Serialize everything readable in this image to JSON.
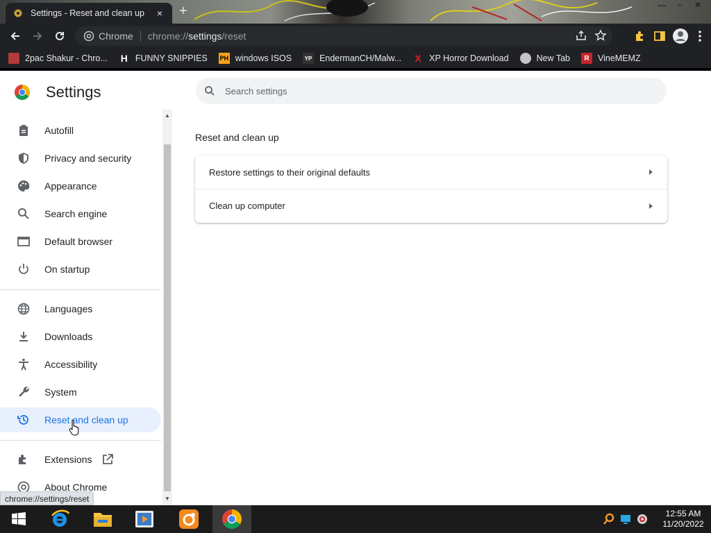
{
  "tab": {
    "title": "Settings - Reset and clean up",
    "close_icon": "×",
    "new_tab_icon": "+"
  },
  "window_controls": {
    "minimize": "—",
    "restore": "▫",
    "close": "✕"
  },
  "omnibox": {
    "site_label": "Chrome",
    "url_prefix": "chrome://",
    "url_host": "settings",
    "url_path": "/reset"
  },
  "bookmarks": [
    {
      "label": "2pac Shakur - Chro...",
      "icon": "image-icon",
      "badge": ""
    },
    {
      "label": "FUNNY SNIPPIES",
      "icon": "h-logo-icon",
      "badge": "H"
    },
    {
      "label": "windows ISOS",
      "icon": "ph-logo-icon",
      "badge": "PH"
    },
    {
      "label": "EndermanCH/Malw...",
      "icon": "yp-logo-icon",
      "badge": "YP"
    },
    {
      "label": "XP Horror Download",
      "icon": "x-logo-icon",
      "badge": "X"
    },
    {
      "label": "New Tab",
      "icon": "globe-icon",
      "badge": ""
    },
    {
      "label": "VineMEMZ",
      "icon": "r-logo-icon",
      "badge": "R"
    }
  ],
  "settings": {
    "title": "Settings",
    "search_placeholder": "Search settings",
    "nav": [
      {
        "label": "Autofill",
        "icon": "clipboard-icon"
      },
      {
        "label": "Privacy and security",
        "icon": "shield-icon"
      },
      {
        "label": "Appearance",
        "icon": "palette-icon"
      },
      {
        "label": "Search engine",
        "icon": "search-icon"
      },
      {
        "label": "Default browser",
        "icon": "browser-icon"
      },
      {
        "label": "On startup",
        "icon": "power-icon"
      },
      {
        "label": "Languages",
        "icon": "globe-icon"
      },
      {
        "label": "Downloads",
        "icon": "download-icon"
      },
      {
        "label": "Accessibility",
        "icon": "accessibility-icon"
      },
      {
        "label": "System",
        "icon": "wrench-icon"
      },
      {
        "label": "Reset and clean up",
        "icon": "history-icon",
        "active": true
      },
      {
        "label": "Extensions",
        "icon": "puzzle-icon"
      },
      {
        "label": "About Chrome",
        "icon": "chrome-icon"
      }
    ],
    "section_title": "Reset and clean up",
    "rows": [
      {
        "label": "Restore settings to their original defaults"
      },
      {
        "label": "Clean up computer"
      }
    ]
  },
  "status_url": "chrome://settings/reset",
  "taskbar": {
    "apps": [
      "start-icon",
      "internet-explorer-icon",
      "file-explorer-icon",
      "media-player-icon",
      "uc-browser-icon",
      "chrome-icon"
    ],
    "time": "12:55 AM",
    "date": "11/20/2022"
  },
  "colors": {
    "accent": "#1a73e8",
    "active_bg": "#e8f0fe",
    "toolbar": "#202124"
  }
}
